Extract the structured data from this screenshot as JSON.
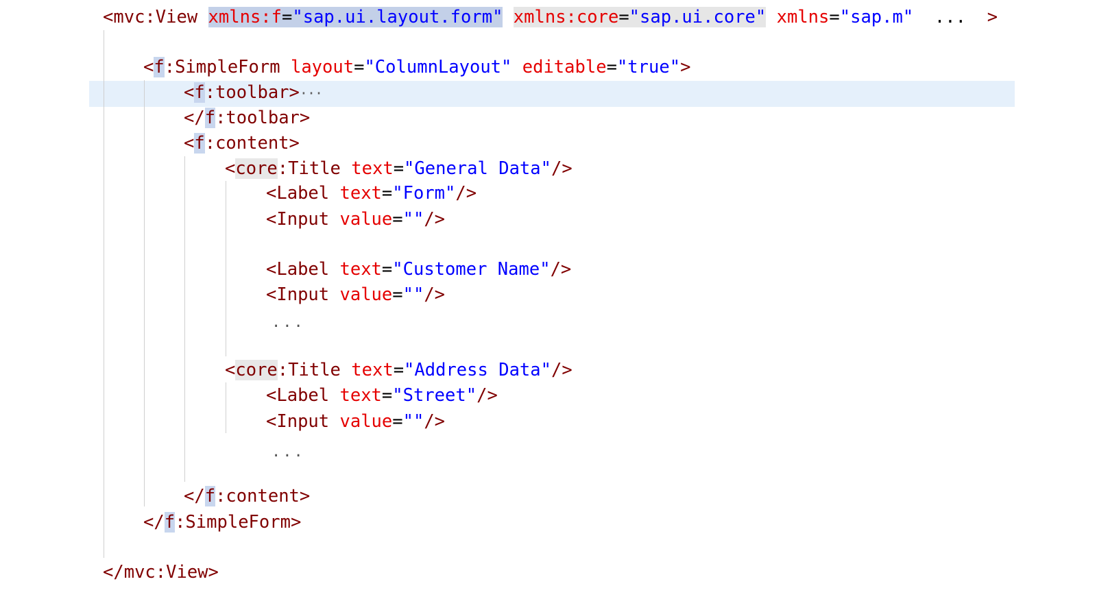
{
  "code": {
    "line1": {
      "open": "<",
      "tag": "mvc:View",
      "space1": " ",
      "attr1": "xmlns:f",
      "eq1": "=",
      "val1": "\"sap.ui.layout.form\"",
      "space2": " ",
      "attr2": "xmlns:core",
      "eq2": "=",
      "val2": "\"sap.ui.core\"",
      "space3": " ",
      "attr3": "xmlns",
      "eq3": "=",
      "val3": "\"sap.m\"",
      "ellipsis": "  ...  ",
      "close": ">"
    },
    "line3": {
      "open": "<",
      "prefix": "f",
      "tag": ":SimpleForm",
      "space1": " ",
      "attr1": "layout",
      "eq1": "=",
      "val1": "\"ColumnLayout\"",
      "space2": " ",
      "attr2": "editable",
      "eq2": "=",
      "val2": "\"true\"",
      "close": ">"
    },
    "line4": {
      "open": "<",
      "prefix": "f",
      "tag": ":toolbar",
      "close": ">",
      "fold": "···"
    },
    "line5": {
      "open": "</",
      "prefix": "f",
      "tag": ":toolbar",
      "close": ">"
    },
    "line6": {
      "open": "<",
      "prefix": "f",
      "tag": ":content",
      "close": ">"
    },
    "line7": {
      "open": "<",
      "prefix": "core",
      "tag": ":Title",
      "space": " ",
      "attr": "text",
      "eq": "=",
      "val": "\"General Data\"",
      "close": "/>"
    },
    "line8": {
      "open": "<",
      "tag": "Label",
      "space": " ",
      "attr": "text",
      "eq": "=",
      "val": "\"Form\"",
      "close": "/>"
    },
    "line9": {
      "open": "<",
      "tag": "Input",
      "space": " ",
      "attr": "value",
      "eq": "=",
      "val": "\"\"",
      "close": "/>"
    },
    "line11": {
      "open": "<",
      "tag": "Label",
      "space": " ",
      "attr": "text",
      "eq": "=",
      "val": "\"Customer Name\"",
      "close": "/>"
    },
    "line12": {
      "open": "<",
      "tag": "Input",
      "space": " ",
      "attr": "value",
      "eq": "=",
      "val": "\"\"",
      "close": "/>"
    },
    "line13": {
      "text": "..."
    },
    "line15": {
      "open": "<",
      "prefix": "core",
      "tag": ":Title",
      "space": " ",
      "attr": "text",
      "eq": "=",
      "val": "\"Address Data\"",
      "close": "/>"
    },
    "line16": {
      "open": "<",
      "tag": "Label",
      "space": " ",
      "attr": "text",
      "eq": "=",
      "val": "\"Street\"",
      "close": "/>"
    },
    "line17": {
      "open": "<",
      "tag": "Input",
      "space": " ",
      "attr": "value",
      "eq": "=",
      "val": "\"\"",
      "close": "/>"
    },
    "line18": {
      "text": "..."
    },
    "line20": {
      "open": "</",
      "prefix": "f",
      "tag": ":content",
      "close": ">"
    },
    "line21": {
      "open": "</",
      "prefix": "f",
      "tag": ":SimpleForm",
      "close": ">"
    },
    "line23": {
      "open": "</",
      "tag": "mvc:View",
      "close": ">"
    }
  },
  "colors": {
    "tag": "#800000",
    "attribute": "#e50000",
    "value": "#0000ff",
    "current_line": "#e5f0fb",
    "namespace_highlight": "#c3d0e8"
  }
}
